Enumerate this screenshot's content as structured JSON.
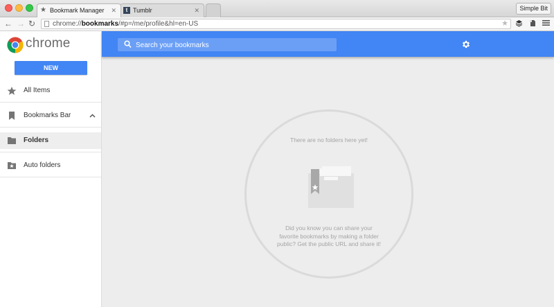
{
  "window": {
    "profile_button": "Simple Bit",
    "tabs": [
      {
        "title": "Bookmark Manager",
        "active": true
      },
      {
        "title": "Tumblr",
        "active": false
      }
    ]
  },
  "address_bar": {
    "url_prefix": "chrome://",
    "url_host": "bookmarks",
    "url_rest": "/#p=/me/profile&hl=en-US"
  },
  "app": {
    "logo_text": "chrome",
    "new_button": "NEW",
    "search_placeholder": "Search your bookmarks",
    "accent_color": "#4285f4",
    "sidebar": {
      "items": [
        {
          "label": "All Items",
          "icon": "star-icon"
        },
        {
          "label": "Bookmarks Bar",
          "icon": "bookmark-icon",
          "expanded": true
        },
        {
          "label": "Folders",
          "icon": "folder-icon",
          "selected": true
        },
        {
          "label": "Auto folders",
          "icon": "star-folder-icon"
        }
      ]
    },
    "empty_state": {
      "title": "There are no folders here yet!",
      "hint": "Did you know you can share your favorite bookmarks by making a folder public? Get the public URL and share it!"
    }
  }
}
